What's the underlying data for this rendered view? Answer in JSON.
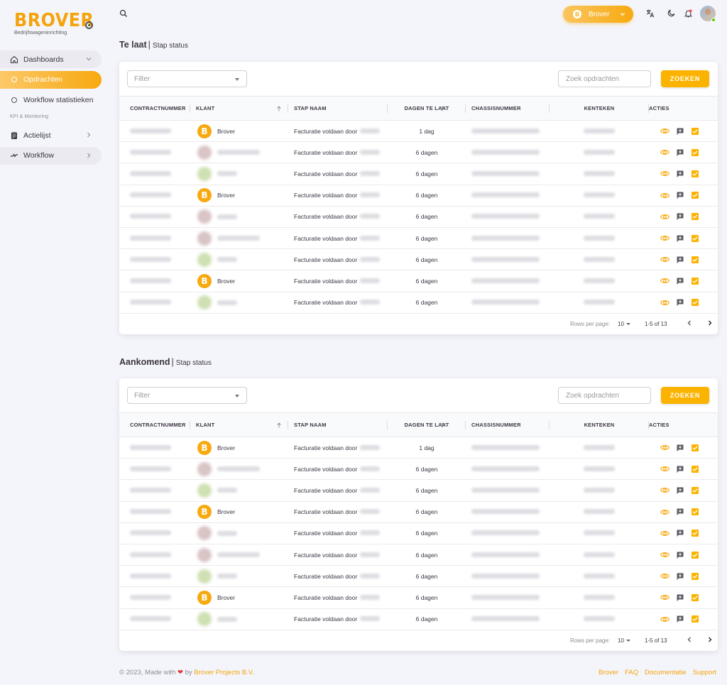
{
  "brand": {
    "logo_text": "BROVER",
    "logo_tagline": "Bedrijfswageninrichting"
  },
  "sidebar": {
    "items": [
      {
        "label": "Dashboards",
        "icon": "home-icon"
      },
      {
        "label": "Opdrachten",
        "icon": "circle-icon"
      },
      {
        "label": "Workflow statistieken",
        "icon": "circle-icon"
      },
      {
        "label": "Actielijst",
        "icon": "clipboard-icon"
      },
      {
        "label": "Workflow",
        "icon": "workflow-icon"
      }
    ],
    "section_label": "KPI & Monitoring"
  },
  "topbar": {
    "org_button_label": "Brover",
    "icons": [
      "search-icon",
      "translate-icon",
      "moon-icon",
      "bell-icon",
      "avatar"
    ]
  },
  "colors": {
    "accent": "#f7a90f",
    "button": "#fbb300"
  },
  "sections": [
    {
      "title": "Te laat",
      "subtitle": "Stap status",
      "filter_placeholder": "Filter",
      "search_placeholder": "Zoek opdrachten",
      "search_button": "ZOEKEN",
      "columns": [
        "Contractnummer",
        "Klant",
        "Stap naam",
        "Dagen te laat",
        "Chassisnummer",
        "Kenteken",
        "Acties"
      ],
      "rows": [
        {
          "klant": "Brover",
          "stap": "Facturatie voldaan door",
          "dagen": "1 dag",
          "brand": true
        },
        {
          "klant": "",
          "stap": "Facturatie voldaan door",
          "dagen": "6 dagen",
          "brand": false,
          "tone": "pink"
        },
        {
          "klant": "",
          "stap": "Facturatie voldaan door",
          "dagen": "6 dagen",
          "brand": false,
          "tone": "green"
        },
        {
          "klant": "Brover",
          "stap": "Facturatie voldaan door",
          "dagen": "6 dagen",
          "brand": true
        },
        {
          "klant": "",
          "stap": "Facturatie voldaan door",
          "dagen": "6 dagen",
          "brand": false,
          "tone": "pink"
        },
        {
          "klant": "",
          "stap": "Facturatie voldaan door",
          "dagen": "6 dagen",
          "brand": false,
          "tone": "pink"
        },
        {
          "klant": "",
          "stap": "Facturatie voldaan door",
          "dagen": "6 dagen",
          "brand": false,
          "tone": "green"
        },
        {
          "klant": "Brover",
          "stap": "Facturatie voldaan door",
          "dagen": "6 dagen",
          "brand": true
        },
        {
          "klant": "",
          "stap": "Facturatie voldaan door",
          "dagen": "6 dagen",
          "brand": false,
          "tone": "green"
        }
      ],
      "rows_per_page_label": "Rows per page:",
      "rows_per_page": "10",
      "range": "1-5 of 13"
    },
    {
      "title": "Aankomend",
      "subtitle": "Stap status",
      "filter_placeholder": "Filter",
      "search_placeholder": "Zoek opdrachten",
      "search_button": "ZOEKEN",
      "columns": [
        "Contractnummer",
        "Klant",
        "Stap naam",
        "Dagen te laat",
        "Chassisnummer",
        "Kenteken",
        "Acties"
      ],
      "rows": [
        {
          "klant": "Brover",
          "stap": "Facturatie voldaan door",
          "dagen": "1 dag",
          "brand": true
        },
        {
          "klant": "",
          "stap": "Facturatie voldaan door",
          "dagen": "6 dagen",
          "brand": false,
          "tone": "pink"
        },
        {
          "klant": "",
          "stap": "Facturatie voldaan door",
          "dagen": "6 dagen",
          "brand": false,
          "tone": "green"
        },
        {
          "klant": "Brover",
          "stap": "Facturatie voldaan door",
          "dagen": "6 dagen",
          "brand": true
        },
        {
          "klant": "",
          "stap": "Facturatie voldaan door",
          "dagen": "6 dagen",
          "brand": false,
          "tone": "pink"
        },
        {
          "klant": "",
          "stap": "Facturatie voldaan door",
          "dagen": "6 dagen",
          "brand": false,
          "tone": "pink"
        },
        {
          "klant": "",
          "stap": "Facturatie voldaan door",
          "dagen": "6 dagen",
          "brand": false,
          "tone": "green"
        },
        {
          "klant": "Brover",
          "stap": "Facturatie voldaan door",
          "dagen": "6 dagen",
          "brand": true
        },
        {
          "klant": "",
          "stap": "Facturatie voldaan door",
          "dagen": "6 dagen",
          "brand": false,
          "tone": "green"
        }
      ],
      "rows_per_page_label": "Rows per page:",
      "rows_per_page": "10",
      "range": "1-5 of 13"
    }
  ],
  "footer": {
    "copyright": "© 2023, Made with",
    "by": "by",
    "company": "Brover Projects B.V.",
    "links": [
      "Brover",
      "FAQ",
      "Documentatie",
      "Support"
    ]
  }
}
